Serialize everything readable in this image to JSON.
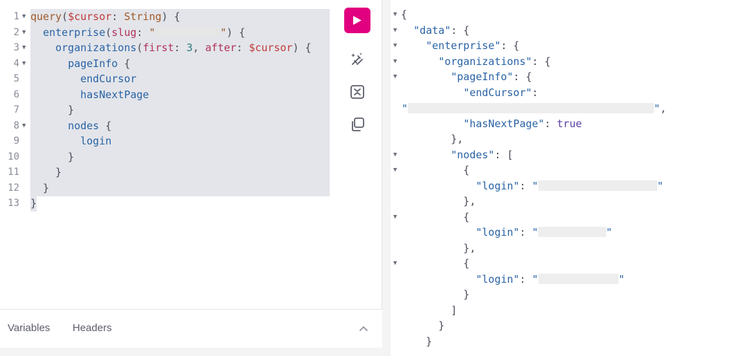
{
  "query": {
    "line_numbers": [
      "1",
      "2",
      "3",
      "4",
      "5",
      "6",
      "7",
      "8",
      "9",
      "10",
      "11",
      "12",
      "13"
    ],
    "kw_query": "query",
    "var_cursor": "$cursor",
    "type_string": "String",
    "fld_enterprise": "enterprise",
    "arg_slug": "slug",
    "fld_organizations": "organizations",
    "arg_first": "first",
    "num_first": "3",
    "arg_after": "after",
    "fld_pageInfo": "pageInfo",
    "fld_endCursor": "endCursor",
    "fld_hasNextPage": "hasNextPage",
    "fld_nodes": "nodes",
    "fld_login": "login"
  },
  "tabs": {
    "variables": "Variables",
    "headers": "Headers"
  },
  "result": {
    "k_data": "\"data\"",
    "k_enterprise": "\"enterprise\"",
    "k_organizations": "\"organizations\"",
    "k_pageInfo": "\"pageInfo\"",
    "k_endCursor": "\"endCursor\"",
    "k_hasNextPage": "\"hasNextPage\"",
    "v_hasNextPage": "true",
    "k_nodes": "\"nodes\"",
    "k_login": "\"login\""
  },
  "icons": {
    "run": "play-icon",
    "prettify": "magic-wand-icon",
    "merge": "merge-fragments-icon",
    "copy": "copy-icon",
    "collapse": "chevron-up-icon"
  },
  "colors": {
    "run_button": "#e1007f"
  }
}
